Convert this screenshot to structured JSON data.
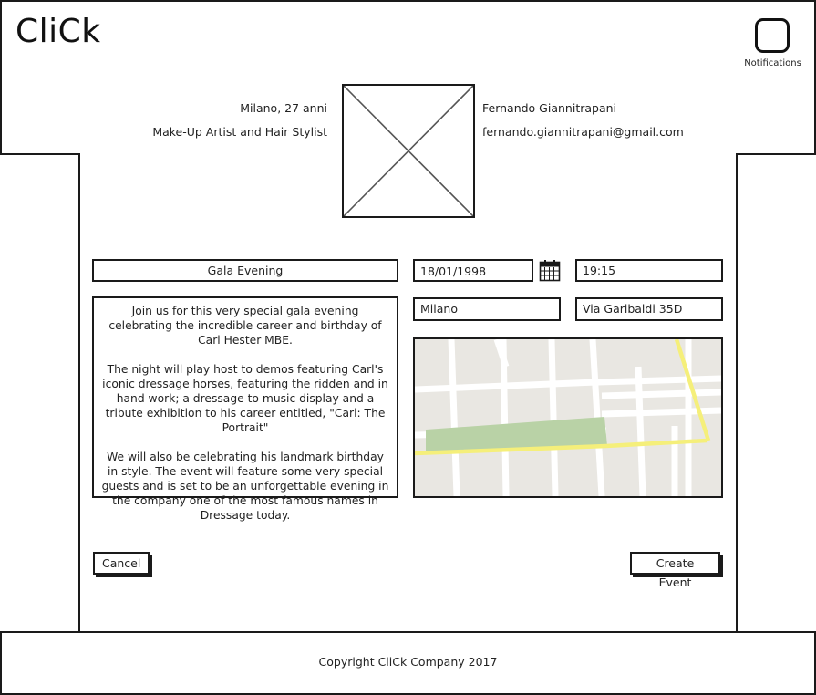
{
  "header": {
    "logo": "CliCk",
    "notifications_label": "Notifications"
  },
  "profile": {
    "location_age": "Milano, 27 anni",
    "profession": "Make-Up Artist and Hair Stylist",
    "full_name": "Fernando Giannitrapani",
    "email": "fernando.giannitrapani@gmail.com",
    "avatar_icon": "image-placeholder-icon"
  },
  "event": {
    "title": "Gala Evening",
    "date": "18/01/1998",
    "date_icon": "calendar-icon",
    "time": "19:15",
    "city": "Milano",
    "address": "Via Garibaldi 35D",
    "description": [
      "Join us for this very special gala evening celebrating the incredible career and birthday of Carl Hester MBE.",
      "The night will play host to demos featuring Carl's iconic dressage horses, featuring the ridden and in hand work; a dressage to music display and a tribute exhibition to his career entitled, \"Carl: The Portrait\"",
      "We will also be celebrating his landmark birthday in style. The event will feature some very special guests and is set to be an unforgettable evening in the company one of the most famous names in Dressage today."
    ]
  },
  "actions": {
    "cancel_label": "Cancel",
    "create_label": "Create Event"
  },
  "footer": {
    "copyright": "Copyright CliCk Company 2017"
  },
  "colors": {
    "border": "#1a1a1a",
    "map_land": "#e9e7e2",
    "map_road": "#ffffff",
    "map_park": "#b9d2a6",
    "map_highway": "#f5ef7a"
  }
}
